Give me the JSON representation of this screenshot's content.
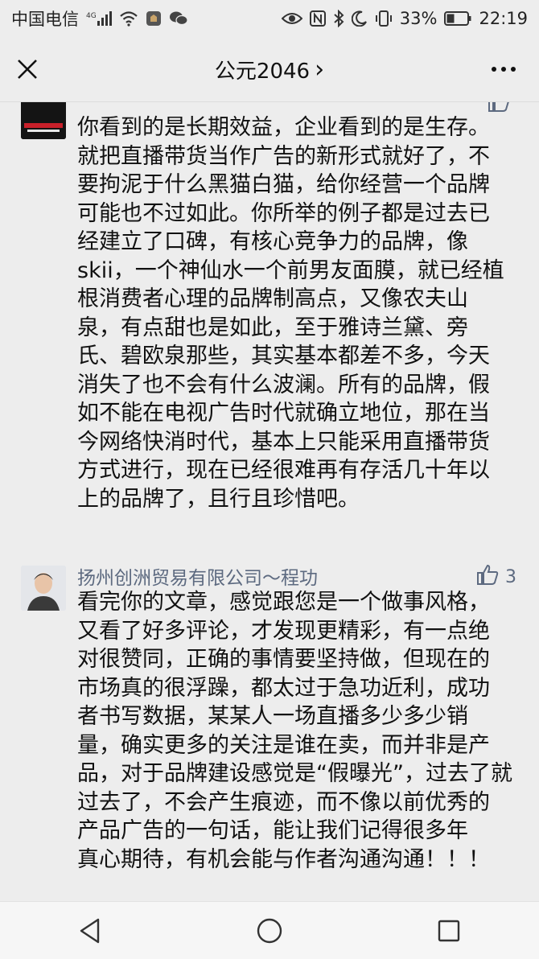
{
  "status_bar": {
    "carrier": "中国电信",
    "network": "4G",
    "battery": "33%",
    "time": "22:19"
  },
  "nav": {
    "title": "公元2046",
    "title_chevron": "›"
  },
  "comments": [
    {
      "name": "",
      "likes": "",
      "text": "你看到的是长期效益，企业看到的是生存。\n就把直播带货当作广告的新形式就好了，不\n要拘泥于什么黑猫白猫，给你经营一个品牌\n可能也不过如此。你所举的例子都是过去已\n经建立了口碑，有核心竞争力的品牌，像\nskii，一个神仙水一个前男友面膜，就已经植\n根消费者心理的品牌制高点，又像农夫山\n泉，有点甜也是如此，至于雅诗兰黛、旁\n氏、碧欧泉那些，其实基本都差不多，今天\n消失了也不会有什么波澜。所有的品牌，假\n如不能在电视广告时代就确立地位，那在当\n今网络快消时代，基本上只能采用直播带货\n方式进行，现在已经很难再有存活几十年以\n上的品牌了，且行且珍惜吧。"
    },
    {
      "name": "扬州创洲贸易有限公司～程功",
      "likes": "3",
      "text": "看完你的文章，感觉跟您是一个做事风格，\n又看了好多评论，才发现更精彩，有一点绝\n对很赞同，正确的事情要坚持做，但现在的\n市场真的很浮躁，都太过于急功近利，成功\n者书写数据，某某人一场直播多少多少销\n量，确实更多的关注是谁在卖，而并非是产\n品，对于品牌建设感觉是“假曝光”，过去了就\n过去了，不会产生痕迹，而不像以前优秀的\n产品广告的一句话，能让我们记得很多年\n真心期待，有机会能与作者沟通沟通！！！"
    }
  ],
  "icons": {
    "close": "close-icon",
    "more": "more-icon",
    "like": "thumbs-up-icon",
    "back": "back-triangle-icon",
    "home": "home-circle-icon",
    "recents": "recents-square-icon"
  },
  "colors": {
    "background": "#ededed",
    "name_color": "#5d6a80",
    "text_color": "#111111"
  }
}
